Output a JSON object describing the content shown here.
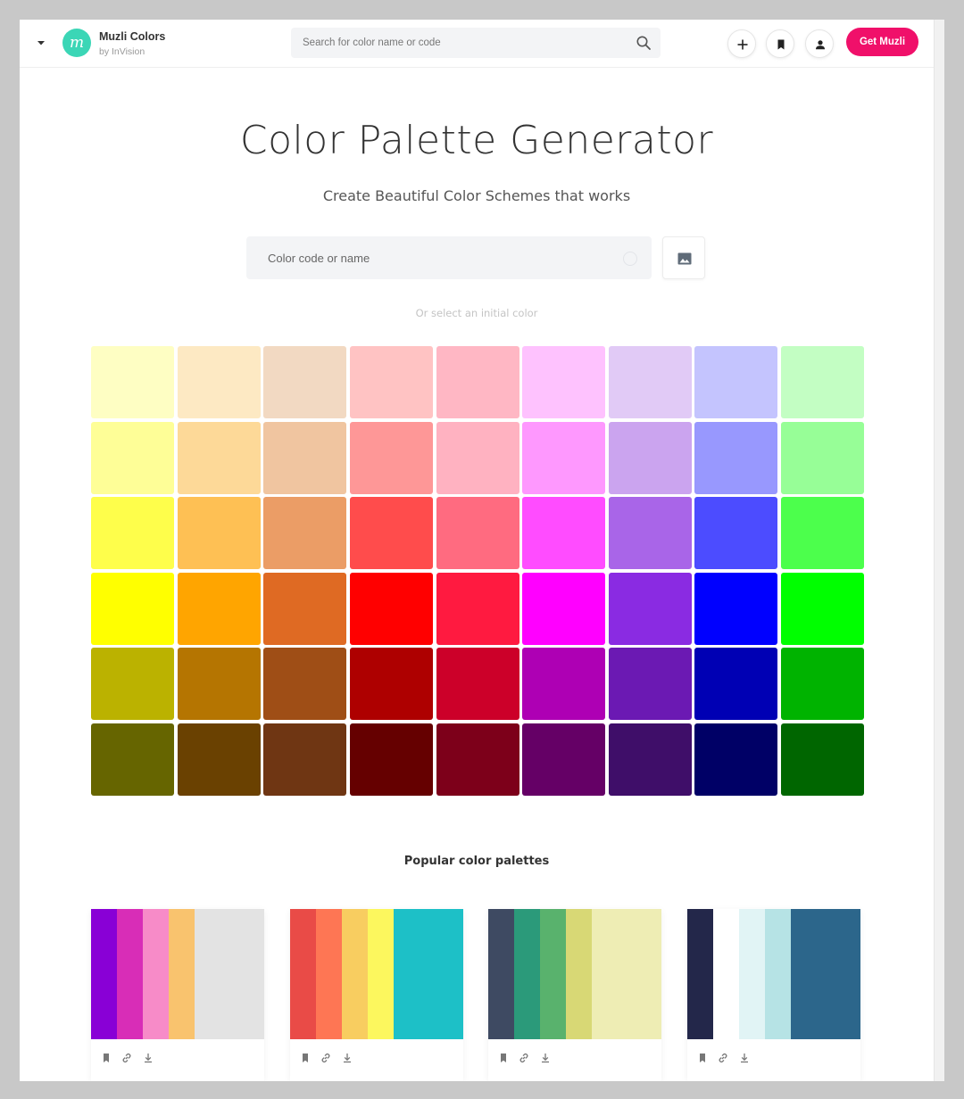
{
  "header": {
    "brand_name": "Muzli Colors",
    "brand_sub": "by InVision",
    "logo_letter": "m",
    "logo_color": "#3bd6b6",
    "search_placeholder": "Search for color name or code",
    "cta_label": "Get Muzli",
    "cta_color": "#f0106a",
    "icons": [
      "chevron-down-icon",
      "search-icon",
      "plus-icon",
      "bookmark-icon",
      "user-icon"
    ]
  },
  "hero": {
    "title": "Color Palette Generator",
    "subtitle": "Create Beautiful Color Schemes that works",
    "color_input_placeholder": "Color code or name",
    "image_button_icon": "image-icon",
    "hint": "Or select an initial color"
  },
  "swatches": [
    [
      "#fefec3",
      "#fde9c3",
      "#f2d9c2",
      "#ffc3c3",
      "#ffb7c4",
      "#fec2fe",
      "#e1caf6",
      "#c4c4fe",
      "#c3fec3"
    ],
    [
      "#fefe97",
      "#fdd998",
      "#f0c5a0",
      "#fe9797",
      "#ffb2c1",
      "#fe98fe",
      "#cba4ef",
      "#9898fe",
      "#97fe97"
    ],
    [
      "#fefe4b",
      "#fec054",
      "#eb9d66",
      "#ff4c4c",
      "#ff6b80",
      "#ff4cff",
      "#a965e8",
      "#4c4cff",
      "#4cff4c"
    ],
    [
      "#ffff00",
      "#ffa500",
      "#df6a23",
      "#ff0000",
      "#ff1a40",
      "#ff00ff",
      "#8a2be2",
      "#0000ff",
      "#00ff00"
    ],
    [
      "#bbb200",
      "#b57501",
      "#9f4e16",
      "#ae0000",
      "#cc0029",
      "#ae00b4",
      "#6b19b3",
      "#0000b4",
      "#00b300"
    ],
    [
      "#666500",
      "#6a4101",
      "#6f3613",
      "#650000",
      "#7d001a",
      "#650066",
      "#3f0e69",
      "#000066",
      "#006600"
    ]
  ],
  "popular": {
    "title": "Popular color palettes",
    "palettes": [
      {
        "colors": [
          "#8900d6",
          "#d82db7",
          "#f78bc8",
          "#f9c36e",
          "#e3e3e3"
        ],
        "weights": [
          1,
          1,
          1,
          1,
          2.7
        ]
      },
      {
        "colors": [
          "#e94b47",
          "#fe7654",
          "#f8cd60",
          "#fcf75e",
          "#1dc0c7"
        ],
        "weights": [
          1,
          1,
          1,
          1,
          2.7
        ]
      },
      {
        "colors": [
          "#3e4a62",
          "#2b9a7a",
          "#59b26d",
          "#d8d875",
          "#eeedb4"
        ],
        "weights": [
          1,
          1,
          1,
          1,
          2.7
        ]
      },
      {
        "colors": [
          "#23274a",
          "#ffffff",
          "#e1f4f5",
          "#b6e3e5",
          "#2c668b"
        ],
        "weights": [
          1,
          1,
          1,
          1,
          2.7
        ]
      }
    ],
    "action_icons": [
      "bookmark-icon",
      "link-icon",
      "download-icon"
    ]
  }
}
